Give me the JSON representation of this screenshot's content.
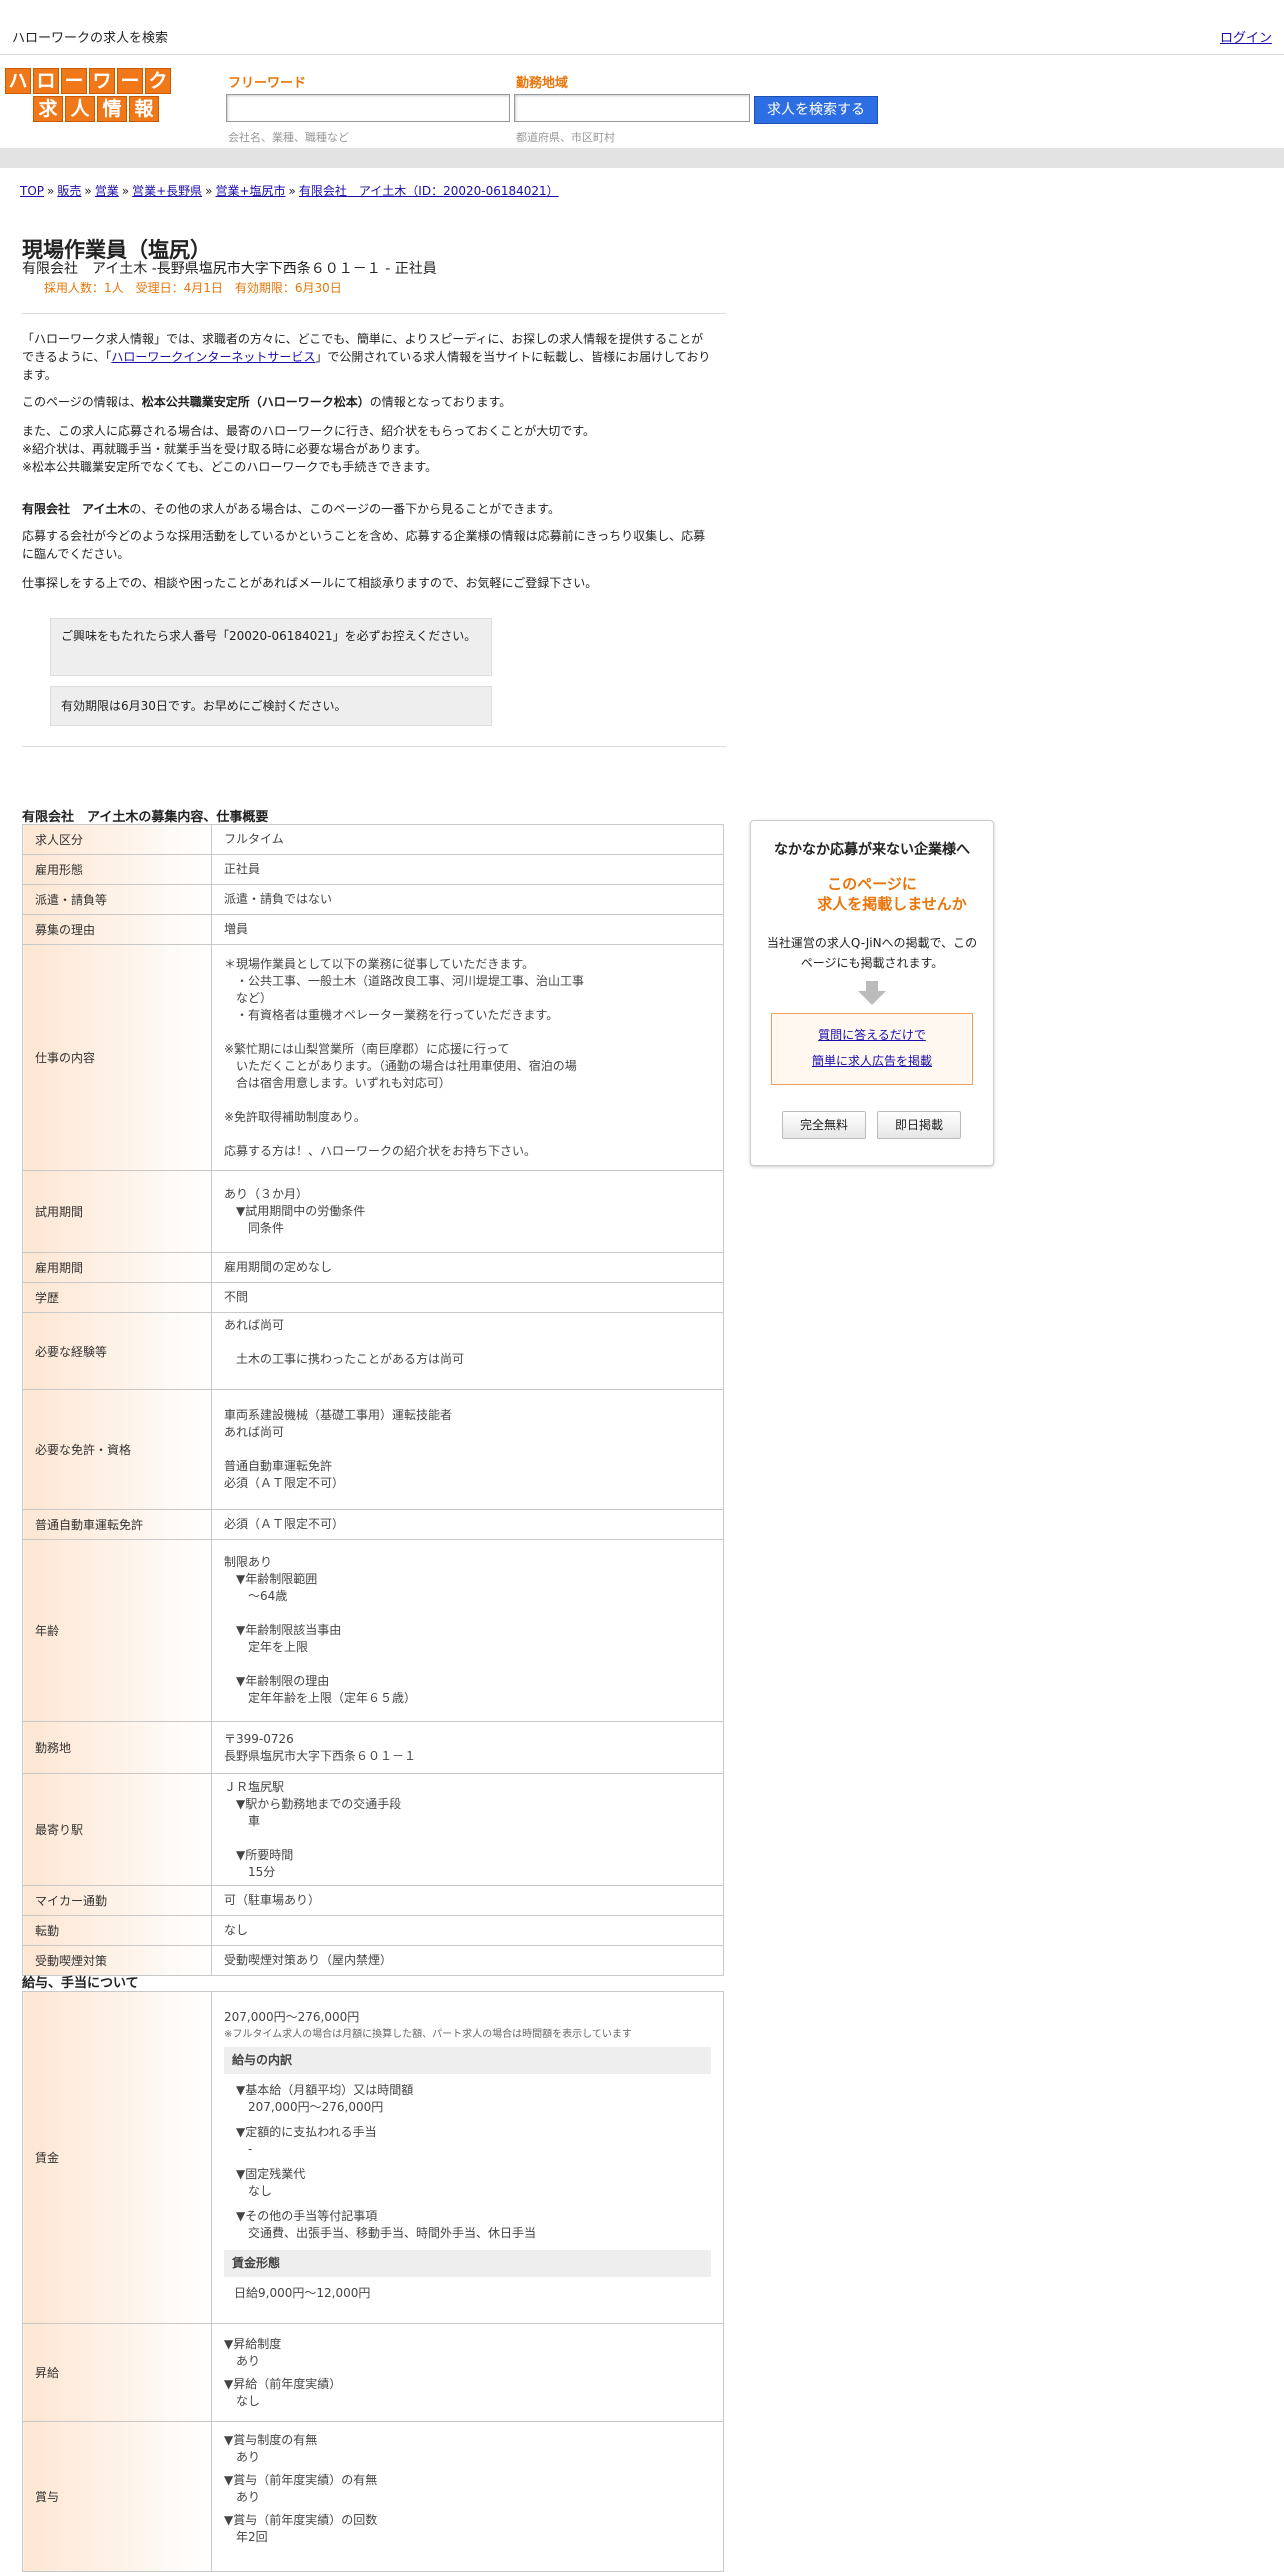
{
  "topbar": {
    "site": "ハローワークの求人を検索",
    "login": "ログイン"
  },
  "logo": {
    "row1": [
      "ハ",
      "ロ",
      "ー",
      "ワ",
      "ー",
      "ク"
    ],
    "row2": [
      "求",
      "人",
      "情",
      "報"
    ]
  },
  "search": {
    "free_label": "フリーワード",
    "free_placeholder": "会社名、業種、職種など",
    "area_label": "勤務地域",
    "area_placeholder": "都道府県、市区町村",
    "button": "求人を検索する"
  },
  "breadcrumb": [
    "TOP",
    "販売",
    "営業",
    "営業+長野県",
    "営業+塩尻市",
    "有限会社　アイ土木（ID：20020-06184021）"
  ],
  "job": {
    "title": "現場作業員（塩尻）",
    "company": "有限会社　アイ土木 -長野県塩尻市大字下西条６０１－１ - 正社員",
    "meta": "採用人数：1人　受理日：4月1日　有効期限：6月30日"
  },
  "intro": {
    "p1a": "「ハローワーク求人情報」では、求職者の方々に、どこでも、簡単に、よりスピーディに、お探しの求人情報を提供することができるように、「",
    "p1link": "ハローワークインターネットサービス",
    "p1b": "」で公開されている求人情報を当サイトに転載し、皆様にお届けしております。",
    "p2a": "このページの情報は、",
    "p2b": "松本公共職業安定所（ハローワーク松本）",
    "p2c": "の情報となっております。",
    "p3": [
      "また、この求人に応募される場合は、最寄のハローワークに行き、紹介状をもらっておくことが大切です。",
      "※紹介状は、再就職手当・就業手当を受け取る時に必要な場合があります。",
      "※松本公共職業安定所でなくても、どこのハローワークでも手続きできます。"
    ],
    "p4a": "有限会社　アイ土木",
    "p4b": "の、その他の求人がある場合は、このページの一番下から見ることができます。",
    "p5": "応募する会社が今どのような採用活動をしているかということを含め、応募する企業様の情報は応募前にきっちり収集し、応募に臨んでください。",
    "p6": "仕事探しをする上での、相談や困ったことがあればメールにて相談承りますので、お気軽にご登録下さい。",
    "notice1": "ご興味をもたれたら求人番号「20020-06184021」を必ずお控えください。",
    "notice2": "有効期限は6月30日です。お早めにご検討ください。"
  },
  "overview": {
    "title": "有限会社　アイ土木の募集内容、仕事概要",
    "rows": [
      {
        "h": "求人区分",
        "v": [
          "フルタイム"
        ]
      },
      {
        "h": "雇用形態",
        "v": [
          "正社員"
        ]
      },
      {
        "h": "派遣・請負等",
        "v": [
          "派遣・請負ではない"
        ]
      },
      {
        "h": "募集の理由",
        "v": [
          "増員"
        ]
      },
      {
        "h": "仕事の内容",
        "v": [
          "＊現場作業員として以下の業務に従事していただきます。",
          "　・公共工事、一般土木（道路改良工事、河川堤堤工事、治山工事",
          "　など）",
          "　・有資格者は重機オペレーター業務を行っていただきます。",
          "",
          "※繁忙期には山梨営業所（南巨摩郡）に応援に行って",
          "　いただくことがあります。（通勤の場合は社用車使用、宿泊の場",
          "　合は宿舎用意します。いずれも対応可）",
          "",
          "※免許取得補助制度あり。",
          "",
          "応募する方は！、ハローワークの紹介状をお持ち下さい。"
        ]
      },
      {
        "h": "試用期間",
        "v": [
          "あり（３か月）",
          "　▼試用期間中の労働条件",
          "　　同条件"
        ]
      },
      {
        "h": "雇用期間",
        "v": [
          "雇用期間の定めなし"
        ]
      },
      {
        "h": "学歴",
        "v": [
          "不問"
        ]
      },
      {
        "h": "必要な経験等",
        "v": [
          "あれば尚可",
          "",
          "　土木の工事に携わったことがある方は尚可",
          ""
        ]
      },
      {
        "h": "必要な免許・資格",
        "v": [
          "車両系建設機械（基礎工事用）運転技能者",
          "あれば尚可",
          "",
          "普通自動車運転免許",
          "必須（ＡＴ限定不可）"
        ]
      },
      {
        "h": "普通自動車運転免許",
        "v": [
          "必須（ＡＴ限定不可）"
        ]
      },
      {
        "h": "年齢",
        "v": [
          "制限あり",
          "　▼年齢制限範囲",
          "　　〜64歳",
          "",
          "　▼年齢制限該当事由",
          "　　定年を上限",
          "",
          "　▼年齢制限の理由",
          "　　定年年齢を上限（定年６５歳）"
        ]
      },
      {
        "h": "勤務地",
        "v": [
          "〒399-0726",
          "長野県塩尻市大字下西条６０１－１"
        ]
      },
      {
        "h": "最寄り駅",
        "v": [
          "ＪＲ塩尻駅",
          "　▼駅から勤務地までの交通手段",
          "　　車",
          "",
          "　▼所要時間",
          "　　15分"
        ]
      },
      {
        "h": "マイカー通勤",
        "v": [
          "可（駐車場あり）"
        ]
      },
      {
        "h": "転勤",
        "v": [
          "なし"
        ]
      },
      {
        "h": "受動喫煙対策",
        "v": [
          "受動喫煙対策あり（屋内禁煙）"
        ]
      }
    ]
  },
  "salary": {
    "title": "給与、手当について",
    "wage_label": "賃金",
    "wage_range": "207,000円〜276,000円",
    "wage_note": "※フルタイム求人の場合は月額に換算した額、パート求人の場合は時間額を表示しています",
    "breakdown_title": "給与の内訳",
    "breakdown": [
      [
        "▼基本給（月額平均）又は時間額",
        "207,000円〜276,000円"
      ],
      [
        "▼定額的に支払われる手当",
        "-"
      ],
      [
        "▼固定残業代",
        "なし"
      ],
      [
        "▼その他の手当等付記事項",
        "交通費、出張手当、移動手当、時間外手当、休日手当"
      ]
    ],
    "form_title": "賃金形態",
    "form_value": "日給9,000円〜12,000円",
    "raise_label": "昇給",
    "raise": [
      [
        "▼昇給制度",
        "あり"
      ],
      [
        "▼昇給（前年度実績）",
        "なし"
      ]
    ],
    "bonus_label": "賞与",
    "bonus": [
      [
        "▼賞与制度の有無",
        "あり"
      ],
      [
        "▼賞与（前年度実績）の有無",
        "あり"
      ],
      [
        "▼賞与（前年度実績）の回数",
        "年2回"
      ]
    ]
  },
  "side": {
    "title": "なかなか応募が来ない企業様へ",
    "offer1": "このページに",
    "offer2": "求人を掲載しませんか",
    "desc": "当社運営の求人Q-JiNへの掲載で、このページにも掲載されます。",
    "link1": "質問に答えるだけで",
    "link2": "簡単に求人広告を掲載",
    "btn1": "完全無料",
    "btn2": "即日掲載",
    "accent": "#e8760a"
  }
}
